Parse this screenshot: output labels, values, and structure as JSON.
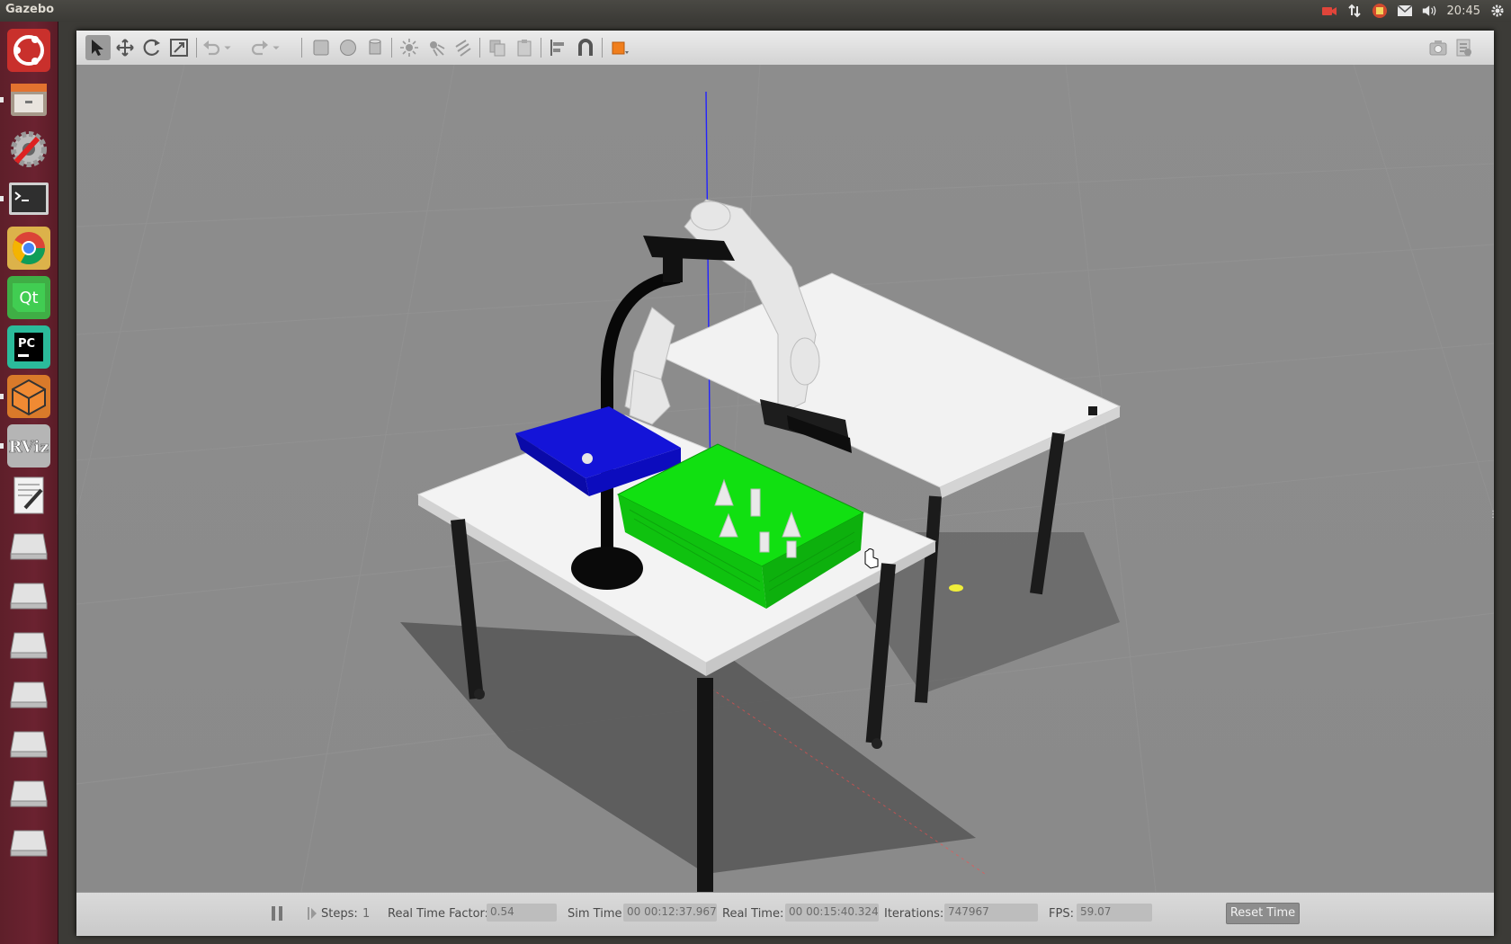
{
  "top_panel": {
    "app_name": "Gazebo",
    "clock": "20:45",
    "indicators": [
      "camera-recorder-icon",
      "network-updown-icon",
      "update-notifier-icon",
      "mail-icon",
      "volume-icon",
      "settings-gear-icon"
    ]
  },
  "launcher": {
    "items": [
      {
        "name": "ubuntu-dash-icon",
        "color": "#d0413c"
      },
      {
        "name": "files-icon",
        "color": "#9a8f7a"
      },
      {
        "name": "system-settings-icon",
        "color": "#cc3a2c"
      },
      {
        "name": "terminal-icon",
        "color": "#2c2c2c"
      },
      {
        "name": "chrome-icon",
        "color": "#4c8bf5"
      },
      {
        "name": "qt-creator-icon",
        "color": "#41cd52"
      },
      {
        "name": "pycharm-icon",
        "color": "#21d789"
      },
      {
        "name": "gazebo-icon",
        "color": "#e77d2e"
      },
      {
        "name": "rviz-icon",
        "color": "#b9b9b9"
      },
      {
        "name": "text-editor-icon",
        "color": "#e6e6e6"
      },
      {
        "name": "drive-icon",
        "color": "#cfcfcf"
      },
      {
        "name": "drive-icon",
        "color": "#cfcfcf"
      },
      {
        "name": "drive-icon",
        "color": "#cfcfcf"
      },
      {
        "name": "drive-icon",
        "color": "#cfcfcf"
      },
      {
        "name": "drive-icon",
        "color": "#cfcfcf"
      },
      {
        "name": "drive-icon",
        "color": "#cfcfcf"
      },
      {
        "name": "drive-icon",
        "color": "#cfcfcf"
      }
    ],
    "rviz_label": "RViz",
    "qt_label": "Qt",
    "pycharm_label": "PC"
  },
  "toolbar": {
    "tools": [
      "select-mode-icon",
      "translate-mode-icon",
      "rotate-mode-icon",
      "scale-mode-icon",
      "undo-icon",
      "undo-dropdown-icon",
      "redo-icon",
      "redo-dropdown-icon",
      "box-shape-icon",
      "sphere-shape-icon",
      "cylinder-shape-icon",
      "point-light-icon",
      "spot-light-icon",
      "directional-light-icon",
      "copy-icon",
      "paste-icon",
      "align-icon",
      "snap-icon",
      "view-angle-icon",
      "screenshot-icon",
      "log-icon"
    ]
  },
  "bottom_bar": {
    "steps_label": "Steps:",
    "steps_value": "1",
    "rtf_label": "Real Time Factor:",
    "rtf_value": "0.54",
    "sim_time_label": "Sim Time:",
    "sim_time_value": "00 00:12:37.967",
    "real_time_label": "Real Time:",
    "real_time_value": "00 00:15:40.324",
    "iterations_label": "Iterations:",
    "iterations_value": "747967",
    "fps_label": "FPS:",
    "fps_value": "59.07",
    "reset_time_label": "Reset Time"
  },
  "scene": {
    "ground_color": "#8a8a8a",
    "table_top_color": "#f2f2f2",
    "basket_blue": "#1414d8",
    "basket_green": "#11e011",
    "lamp_color": "#080808",
    "axis_z_color": "#2222ff",
    "axis_x_color": "#ff2222"
  }
}
